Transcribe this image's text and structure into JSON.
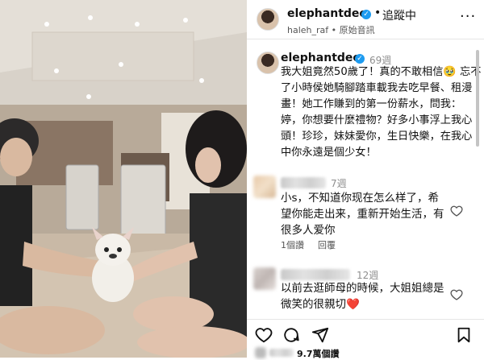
{
  "post": {
    "username": "elephantdee",
    "follow_label": "追蹤中",
    "subtitle": "haleh_raf • 原始音訊",
    "more_label": "···"
  },
  "caption": {
    "username": "elephantdee",
    "age": "69週",
    "text": "我大姐竟然50歲了！真的不敢相信🥹 忘不了小時侯她騎腳踏車載我去吃早餐、租漫畫！她工作賺到的第一份薪水，問我：婷，你想要什麼禮物？好多小事浮上我心頭！珍珍，妹妹愛你，生日快樂，在我心中你永遠是個少女！"
  },
  "comments": [
    {
      "age": "7週",
      "text": "小s，不知道你现在怎么样了，希望你能走出来，重新开始生活，有很多人爱你",
      "replies_label": "1個讚",
      "reply_label": "回覆"
    },
    {
      "age": "12週",
      "text": "以前去逛師母的時候，大姐姐總是微笑的很親切❤️"
    }
  ],
  "actions": {
    "icons": [
      "heart-icon",
      "comment-icon",
      "share-icon",
      "bookmark-icon"
    ]
  },
  "likes": {
    "text": "9.7萬個讚"
  },
  "colors": {
    "verified": "#1d9bf0",
    "text": "#111111",
    "muted": "#8e8e8e"
  }
}
